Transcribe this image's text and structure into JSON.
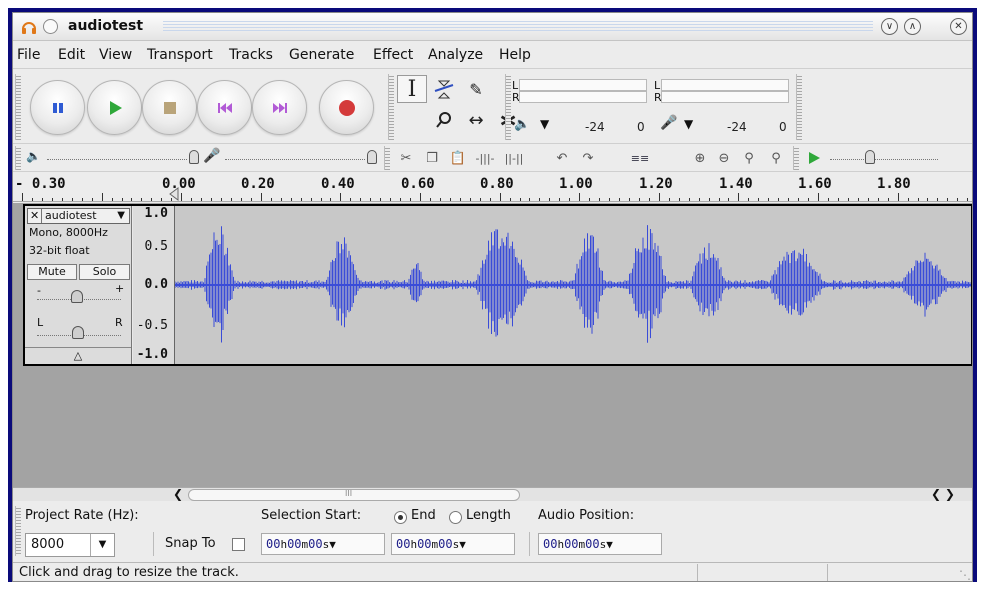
{
  "window": {
    "title": "audiotest",
    "controls": [
      "chevron-down-icon",
      "chevron-up-icon",
      "close-icon"
    ]
  },
  "menubar": {
    "items": [
      {
        "label": "File"
      },
      {
        "label": "Edit"
      },
      {
        "label": "View"
      },
      {
        "label": "Transport"
      },
      {
        "label": "Tracks"
      },
      {
        "label": "Generate"
      },
      {
        "label": "Effect"
      },
      {
        "label": "Analyze"
      },
      {
        "label": "Help"
      }
    ]
  },
  "transport": {
    "buttons": [
      {
        "name": "pause",
        "icon": "pause-icon",
        "color": "#2f5bd3"
      },
      {
        "name": "play",
        "icon": "play-icon",
        "color": "#2fa83a"
      },
      {
        "name": "stop",
        "icon": "stop-icon",
        "color": "#b9a47a"
      },
      {
        "name": "skip-start",
        "icon": "skip-start-icon",
        "color": "#b25bd6"
      },
      {
        "name": "skip-end",
        "icon": "skip-end-icon",
        "color": "#b25bd6"
      },
      {
        "name": "record",
        "icon": "record-icon",
        "color": "#d43a3a"
      }
    ]
  },
  "meters": {
    "playback": {
      "left_label": "L",
      "right_label": "R",
      "db_value": "-24",
      "db_end": "0"
    },
    "record": {
      "left_label": "L",
      "right_label": "R",
      "db_value": "-24",
      "db_end": "0"
    }
  },
  "ruler": {
    "labels": [
      "- 0.30",
      "0.00",
      "0.20",
      "0.40",
      "0.60",
      "0.80",
      "1.00",
      "1.20",
      "1.40",
      "1.60",
      "1.80"
    ]
  },
  "track": {
    "name": "audiotest",
    "format": "Mono, 8000Hz",
    "bit_depth": "32-bit float",
    "mute_label": "Mute",
    "solo_label": "Solo",
    "gain_minus": "-",
    "gain_plus": "+",
    "pan_left": "L",
    "pan_right": "R",
    "collapse_icon": "triangle-up-icon",
    "scale": [
      "1.0",
      "0.5",
      "0.0",
      "-0.5",
      "-1.0"
    ],
    "waveform_color": "#3a4cd8"
  },
  "selection_toolbar": {
    "project_rate_label": "Project Rate (Hz):",
    "project_rate_value": "8000",
    "snap_label": "Snap To",
    "selection_start_label": "Selection Start:",
    "end_label": "End",
    "length_label": "Length",
    "audio_position_label": "Audio Position:",
    "start_time": {
      "h": "00",
      "m": "00",
      "s": "00"
    },
    "end_time": {
      "h": "00",
      "m": "00",
      "s": "00"
    },
    "position_time": {
      "h": "00",
      "m": "00",
      "s": "00"
    },
    "unit_h": "h",
    "unit_m": "m",
    "unit_s": "s"
  },
  "scrollbar": {
    "center_mark": "III"
  },
  "status": {
    "text": "Click and drag to resize the track."
  }
}
